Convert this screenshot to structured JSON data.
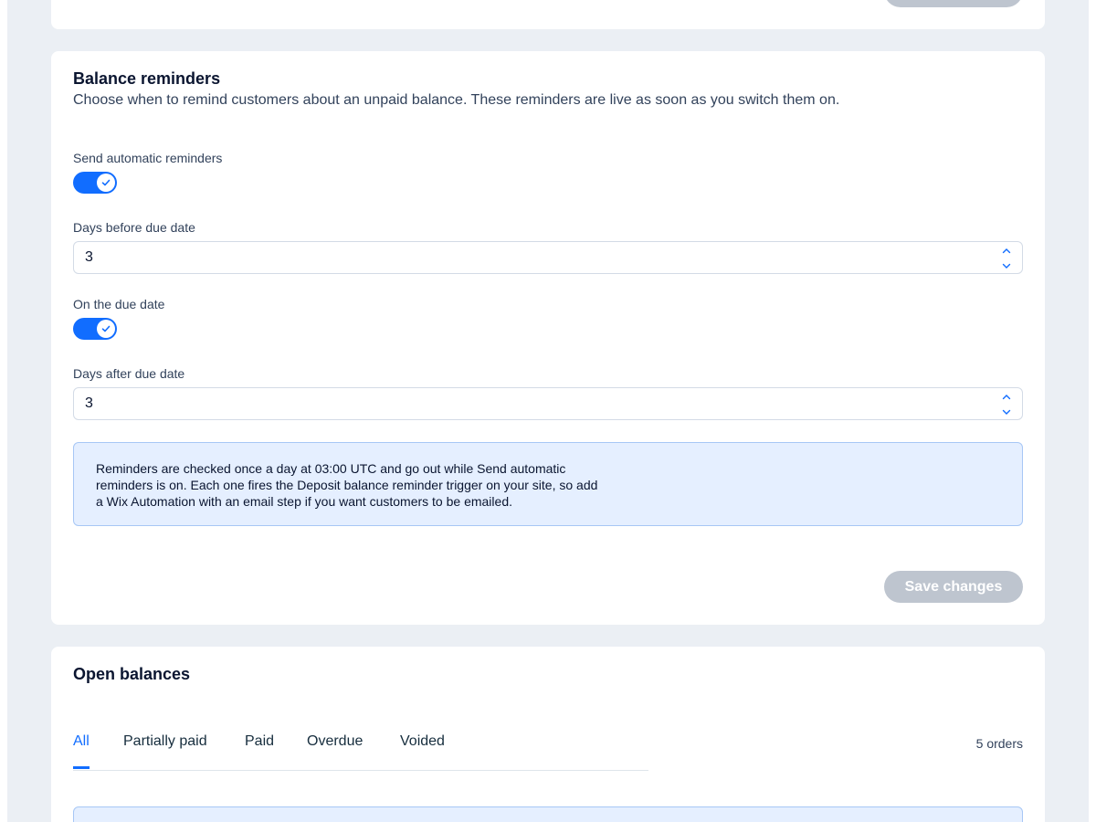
{
  "reminders": {
    "title": "Balance reminders",
    "description": "Choose when to remind customers about an unpaid balance. These reminders are live as soon as you switch them on.",
    "auto_label": "Send automatic reminders",
    "auto_enabled": true,
    "before_label": "Days before due date",
    "before_value": "3",
    "on_due_label": "On the due date",
    "on_due_enabled": true,
    "after_label": "Days after due date",
    "after_value": "3",
    "info_text": "Reminders are checked once a day at 03:00 UTC and go out while Send automatic reminders is on. Each one fires the Deposit balance reminder trigger on your site, so add a Wix Automation with an email step if you want customers to be emailed.",
    "save_label": "Save changes"
  },
  "balances": {
    "title": "Open balances",
    "tabs": [
      {
        "label": "All"
      },
      {
        "label": "Partially paid"
      },
      {
        "label": "Paid"
      },
      {
        "label": "Overdue"
      },
      {
        "label": "Voided"
      }
    ],
    "active_tab": "All",
    "orders_count": "5 orders"
  },
  "icons": {
    "toggle_check": "check-icon",
    "stepper_up": "chevron-up-icon",
    "stepper_down": "chevron-down-icon"
  },
  "colors": {
    "accent": "#116dff",
    "disabled_button": "#bec5cf",
    "info_bg": "#e5efff",
    "page_bg": "#ebeff4"
  }
}
